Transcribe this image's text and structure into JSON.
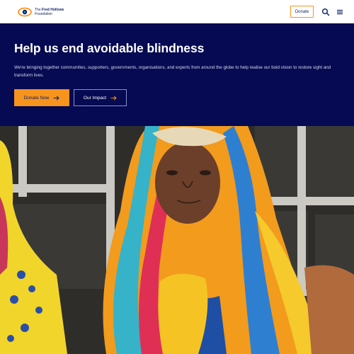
{
  "header": {
    "brand_line1_prefix": "The",
    "brand_line1_name": "Fred Hollows",
    "brand_line2": "Foundation",
    "donate_label": "Donate",
    "search_icon": "search-icon",
    "menu_icon": "hamburger-menu-icon"
  },
  "hero": {
    "title": "Help us end avoidable blindness",
    "subtitle": "We're bringing together communities, supporters, governments, organisations, and experts from around the globe to help realise our bold vision to restore sight and transform lives.",
    "primary_button": "Donate Now",
    "secondary_button": "Our Impact"
  },
  "colors": {
    "navy": "#050a52",
    "accent_orange": "#f7941d",
    "white": "#ffffff"
  }
}
